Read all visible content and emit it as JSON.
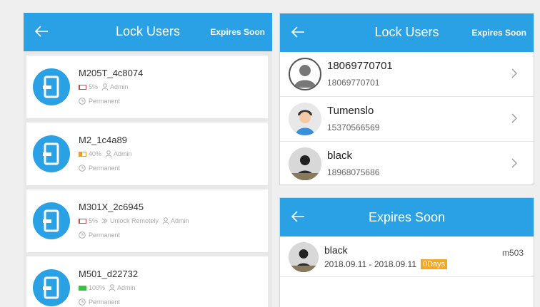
{
  "left_panel": {
    "title": "Lock Users",
    "expires_link": "Expires Soon",
    "locks": [
      {
        "name": "M205T_4c8074",
        "battery": "5%",
        "battery_level": 0.05,
        "battery_color": "#e04040",
        "remote": "",
        "role": "Admin",
        "validity": "Permanent"
      },
      {
        "name": "M2_1c4a89",
        "battery": "40%",
        "battery_level": 0.4,
        "battery_color": "#f49a1e",
        "remote": "",
        "role": "Admin",
        "validity": "Permanent"
      },
      {
        "name": "M301X_2c6945",
        "battery": "5%",
        "battery_level": 0.05,
        "battery_color": "#e04040",
        "remote": "Unlock Remotely",
        "role": "Admin",
        "validity": "Permanent"
      },
      {
        "name": "M501_d22732",
        "battery": "100%",
        "battery_level": 1.0,
        "battery_color": "#36c43a",
        "remote": "",
        "role": "Admin",
        "validity": "Permanent"
      }
    ]
  },
  "users_panel": {
    "title": "Lock Users",
    "expires_link": "Expires Soon",
    "users": [
      {
        "name": "18069770701",
        "phone": "18069770701",
        "avatar": "default-avatar-icon"
      },
      {
        "name": "Tumenslo",
        "phone": "15370566569",
        "avatar": "cartoon-avatar-icon"
      },
      {
        "name": "black",
        "phone": "18968075686",
        "avatar": "photo-avatar-icon"
      }
    ]
  },
  "expires_panel": {
    "title": "Expires Soon",
    "entries": [
      {
        "name": "black",
        "range": "2018.09.11 - 2018.09.11",
        "days": "0Days",
        "device": "m503"
      }
    ]
  },
  "colors": {
    "accent": "#2aa1e5",
    "days_badge": "#f5a623"
  }
}
